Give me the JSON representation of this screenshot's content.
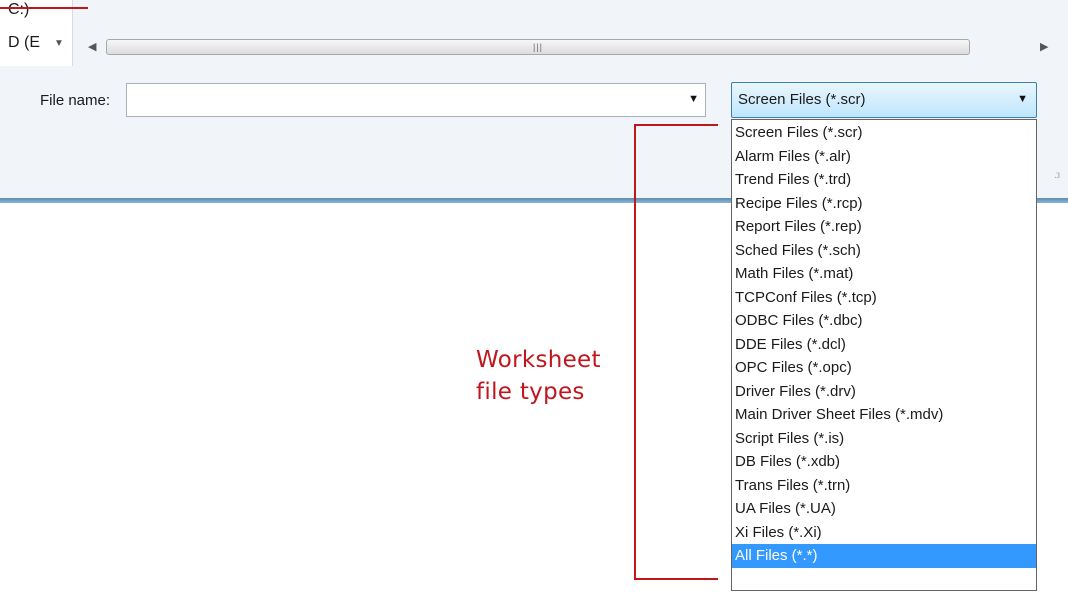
{
  "nav": {
    "items": [
      {
        "label": "C:)"
      },
      {
        "label": "D (E"
      }
    ],
    "expand_icon": "triangle-down-icon"
  },
  "scrollbar": {
    "left_icon": "scroll-left-arrow-icon",
    "right_icon": "scroll-right-arrow-icon",
    "grip_icon": "grip-lines-icon"
  },
  "file_name": {
    "label": "File name:",
    "value": "",
    "dropdown_icon": "dropdown-arrow-icon"
  },
  "file_type": {
    "selected": "Screen Files (*.scr)",
    "dropdown_icon": "dropdown-arrow-icon",
    "highlighted_option": "All Files (*.*)",
    "options": [
      "Screen Files (*.scr)",
      "Alarm Files (*.alr)",
      "Trend Files (*.trd)",
      "Recipe Files (*.rcp)",
      "Report Files (*.rep)",
      "Sched Files (*.sch)",
      "Math Files (*.mat)",
      "TCPConf Files (*.tcp)",
      "ODBC Files (*.dbc)",
      "DDE Files (*.dcl)",
      "OPC Files (*.opc)",
      "Driver Files (*.drv)",
      "Main Driver Sheet Files (*.mdv)",
      "Script Files (*.is)",
      "DB Files (*.xdb)",
      "Trans Files (*.trn)",
      "UA Files (*.UA)",
      "Xi Files (*.Xi)",
      "All Files (*.*)"
    ]
  },
  "annotation": {
    "line1": "Worksheet",
    "line2": "file types",
    "color": "#c0161d"
  },
  "colors": {
    "selection": "#3399ff",
    "combo_border": "#3c7fb1",
    "dialog_background": "#f1f4f8"
  }
}
